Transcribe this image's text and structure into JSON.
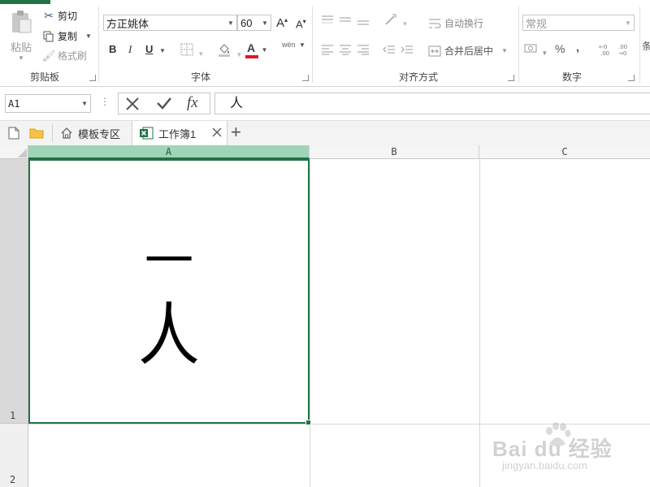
{
  "ribbon": {
    "clipboard": {
      "paste_label": "粘贴",
      "cut_label": "剪切",
      "copy_label": "复制",
      "format_painter_label": "格式刷",
      "group_label": "剪贴板"
    },
    "font": {
      "font_name": "方正姚体",
      "font_size": "60",
      "increase_label": "A",
      "decrease_label": "A",
      "bold_label": "B",
      "italic_label": "I",
      "underline_label": "U",
      "font_color_label": "A",
      "phonetic_label": "wén",
      "group_label": "字体",
      "font_color_accent": "#e81123"
    },
    "alignment": {
      "wrap_text_label": "自动换行",
      "merge_center_label": "合并后居中",
      "group_label": "对齐方式"
    },
    "number": {
      "format_value": "常规",
      "percent_label": "%",
      "comma_label": ",",
      "group_label": "数字"
    },
    "partial_next_group": "条"
  },
  "formula_bar": {
    "name_box": "A1",
    "fx_label": "fx",
    "content": "人"
  },
  "tabs": {
    "template_tab": "模板专区",
    "workbook_tab": "工作簿1",
    "add_label": "+"
  },
  "grid": {
    "columns": [
      "A",
      "B",
      "C"
    ],
    "rows": [
      "1",
      "2"
    ],
    "cell_a1_line1": "一",
    "cell_a1_line2": "人",
    "selection_color": "#217346",
    "selected_header_color": "#9fd5b7"
  },
  "watermark": {
    "brand": "Bai du 经验",
    "url": "jingyan.baidu.com"
  }
}
